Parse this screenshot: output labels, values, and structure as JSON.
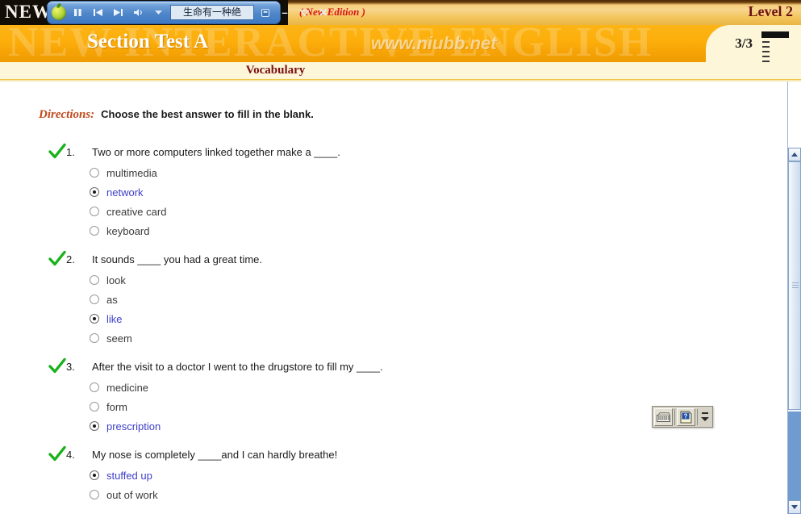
{
  "topbar": {
    "brand": "NEW",
    "edition": "( New Edition )",
    "level": "Level 2",
    "player": {
      "logo_icon": "apple-logo-icon",
      "pause_icon": "pause-icon",
      "prev_icon": "previous-track-icon",
      "next_icon": "next-track-icon",
      "volume_icon": "volume-icon",
      "volume_dropdown_icon": "chevron-down-icon",
      "track_title": "生命有一种绝",
      "restore_icon": "restore-window-icon",
      "minimize_label": "–",
      "collapse_icon": "chevron-down-icon",
      "close_label": "✕"
    }
  },
  "header": {
    "title": "Section Test A",
    "watermark_interactive": "NEW INTERACTIVE ENGLISH",
    "watermark_url": "www.niubb.net",
    "page_indicator": "3/3",
    "subtitle": "Vocabulary"
  },
  "directions": {
    "label": "Directions:",
    "text": "Choose the best answer to fill in the blank."
  },
  "questions": [
    {
      "status_icon": "green-check-icon",
      "number": "1.",
      "text": "Two or more computers linked together make a ____.",
      "options": [
        {
          "label": "multimedia",
          "selected": false
        },
        {
          "label": "network",
          "selected": true
        },
        {
          "label": "creative card",
          "selected": false
        },
        {
          "label": "keyboard",
          "selected": false
        }
      ]
    },
    {
      "status_icon": "green-check-icon",
      "number": "2.",
      "text": "It sounds ____ you had a great time.",
      "options": [
        {
          "label": "look",
          "selected": false
        },
        {
          "label": "as",
          "selected": false
        },
        {
          "label": "like",
          "selected": true
        },
        {
          "label": "seem",
          "selected": false
        }
      ]
    },
    {
      "status_icon": "green-check-icon",
      "number": "3.",
      "text": "After the visit to a doctor I went to the drugstore to fill my ____.",
      "options": [
        {
          "label": "medicine",
          "selected": false
        },
        {
          "label": "form",
          "selected": false
        },
        {
          "label": "prescription",
          "selected": true
        }
      ]
    },
    {
      "status_icon": "green-check-icon",
      "number": "4.",
      "text": "My nose is completely ____and I can hardly breathe!",
      "options": [
        {
          "label": "stuffed up",
          "selected": true
        },
        {
          "label": "out of work",
          "selected": false
        }
      ]
    }
  ],
  "floating_toolbar": {
    "keyboard_icon": "keyboard-icon",
    "help_icon": "help-question-icon",
    "spinner_icon": "spinner-updown-icon"
  },
  "scrollbar": {
    "up_icon": "scroll-up-arrow-icon",
    "down_icon": "scroll-down-arrow-icon",
    "thumb_icon": "scrollbar-thumb"
  },
  "colors": {
    "header_orange": "#fbb415",
    "subheader_cream": "#fdf6d8",
    "accent_red": "#d81616",
    "level_dark_red": "#6d1111",
    "directions_orange": "#c0491b",
    "selected_blue": "#3e3ec8",
    "check_green": "#19b219"
  }
}
